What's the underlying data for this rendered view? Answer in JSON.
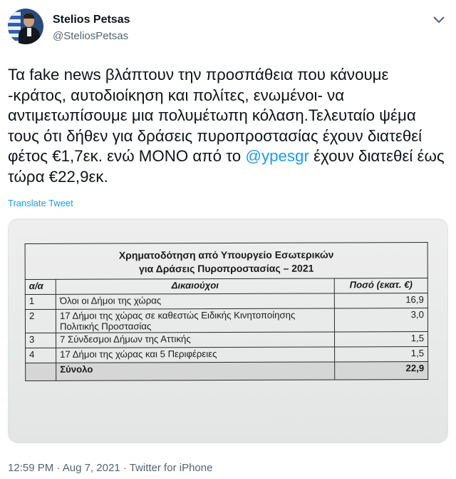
{
  "author": {
    "name": "Stelios Petsas",
    "handle": "@SteliosPetsas"
  },
  "more_icon": "chevron-down-icon",
  "tweet": {
    "text_before": "Τα fake news βλάπτουν την προσπάθεια που κάνουμε -κράτος, αυτοδιοίκηση και πολίτες, ενωμένοι- να αντιμετωπίσουμε μια πολυμέτωπη κόλαση.Τελευταίο ψέμα τους ότι δήθεν για δράσεις πυροπροστασίας έχουν διατεθεί φέτος  €1,7εκ. ενώ ΜΟΝΟ από το ",
    "mention": "@ypesgr",
    "text_after": " έχουν διατεθεί έως τώρα €22,9εκ."
  },
  "translate_label": "Translate Tweet",
  "media": {
    "title_line1": "Χρηματοδότηση από Υπουργείο Εσωτερικών",
    "title_line2": "για Δράσεις Πυροπροστασίας – 2021",
    "headers": {
      "num": "α/α",
      "beneficiary": "Δικαιούχοι",
      "amount": "Ποσό (εκατ. €)"
    },
    "rows": [
      {
        "num": "1",
        "beneficiary": "Όλοι οι Δήμοι της χώρας",
        "amount": "16,9"
      },
      {
        "num": "2",
        "beneficiary": "17 Δήμοι της χώρας σε καθεστώς Ειδικής Κινητοποίησης Πολιτικής Προστασίας",
        "amount": "3,0"
      },
      {
        "num": "3",
        "beneficiary": "7 Σύνδεσμοι Δήμων της Αττικής",
        "amount": "1,5"
      },
      {
        "num": "4",
        "beneficiary": "17 Δήμοι της χώρας και 5 Περιφέρειες",
        "amount": "1,5"
      }
    ],
    "total": {
      "label": "Σύνολο",
      "amount": "22,9"
    }
  },
  "footer": {
    "time": "12:59 PM",
    "date": "Aug 7, 2021",
    "source": "Twitter for iPhone",
    "separator": "·"
  },
  "colors": {
    "link": "#1d9bf0",
    "secondary_text": "#536471",
    "primary_text": "#0f1419"
  }
}
